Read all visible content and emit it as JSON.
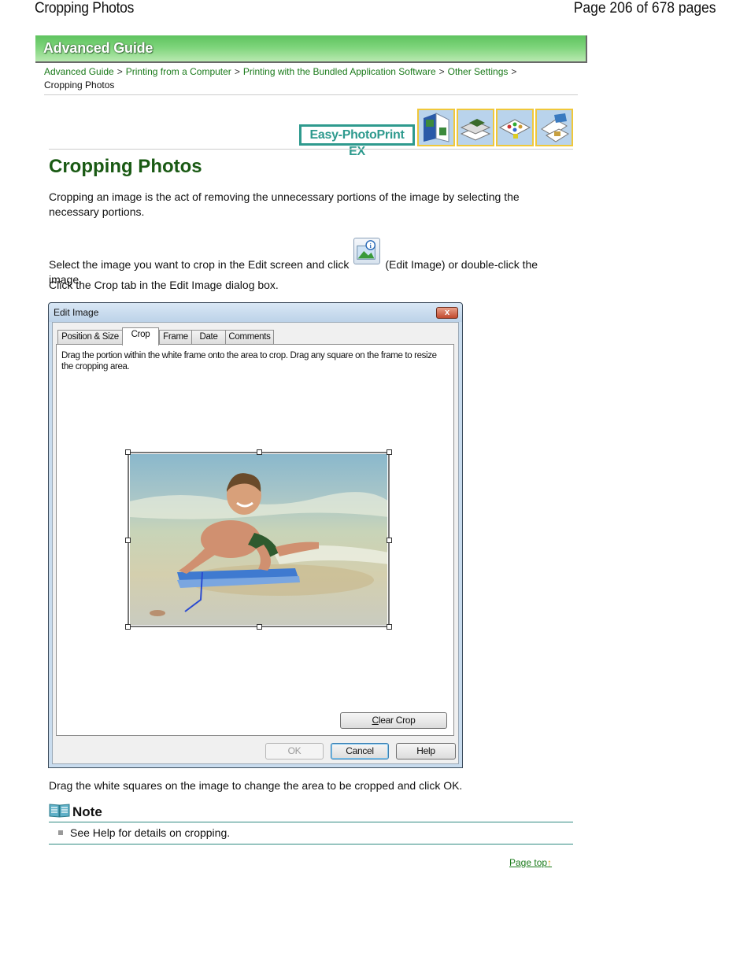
{
  "header": {
    "doc_title": "Cropping Photos",
    "page_count": "Page 206 of 678 pages"
  },
  "banner": {
    "label": "Advanced Guide"
  },
  "breadcrumb": {
    "items": [
      "Advanced Guide",
      "Printing from a Computer",
      "Printing with the Bundled Application Software",
      "Other Settings"
    ],
    "separator": ">",
    "current": "Cropping Photos"
  },
  "product": {
    "logo_text": "Easy-PhotoPrint EX",
    "tiles": [
      "album-icon",
      "stickers-icon",
      "layout-print-icon",
      "calendar-icon"
    ]
  },
  "main": {
    "title": "Cropping Photos",
    "intro": "Cropping an image is the act of removing the unnecessary portions of the image by selecting the necessary portions.",
    "step1_before": "Select the image you want to crop in the Edit screen and click",
    "step1_after": "(Edit Image) or double-click the image.",
    "step2": "Click the Crop tab in the Edit Image dialog box.",
    "step3": "Drag the white squares on the image to change the area to be cropped and click OK."
  },
  "dialog": {
    "title": "Edit Image",
    "close_label": "x",
    "tabs": [
      {
        "label": "Position & Size",
        "active": false
      },
      {
        "label": "Crop",
        "active": true
      },
      {
        "label": "Frame",
        "active": false
      },
      {
        "label": "Date",
        "active": false
      },
      {
        "label": "Comments",
        "active": false
      }
    ],
    "instruction": "Drag the portion within the white frame onto the area to crop. Drag any square on the frame to resize the cropping area.",
    "clear_crop": {
      "accel": "C",
      "rest": "lear Crop"
    },
    "ok": "OK",
    "cancel": "Cancel",
    "help": "Help"
  },
  "note": {
    "label": "Note",
    "items": [
      "See Help for details on cropping."
    ]
  },
  "footer": {
    "page_top": "Page top",
    "page_top_arrow": "↑"
  },
  "colors": {
    "link_green": "#1a7a1a",
    "heading_green": "#1a5a14",
    "teal_rule": "#2e8a80",
    "banner_green": "#5fc35f"
  }
}
